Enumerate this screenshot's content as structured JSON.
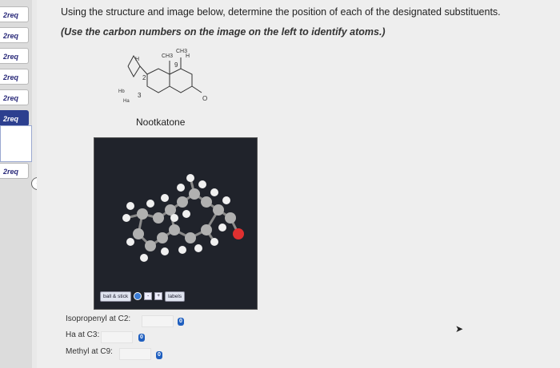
{
  "sidebar": {
    "tabs": [
      {
        "label": "2req",
        "active": false
      },
      {
        "label": "2req",
        "active": false
      },
      {
        "label": "2req",
        "active": false
      },
      {
        "label": "2req",
        "active": false
      },
      {
        "label": "2req",
        "active": false
      },
      {
        "label": "2req",
        "active": true
      },
      {
        "label": "2req",
        "active": false
      }
    ],
    "collapse_icon": "chevron-left-icon"
  },
  "question": {
    "text": "Using the structure and image below, determine the position of each of the designated substituents.",
    "instruction": "(Use the carbon numbers on the image on the left to identify atoms.)"
  },
  "structure": {
    "labels": [
      "H",
      "CH3",
      "H",
      "CH3",
      "2",
      "9",
      "Hb",
      "Ha",
      "3",
      "O"
    ],
    "caption": "Nootkatone"
  },
  "viewer": {
    "mode_label": "ball & stick",
    "labels_label": "labels",
    "plus_label": "+",
    "minus_label": "-"
  },
  "answers": [
    {
      "label": "Isopropenyl at C2:",
      "value": ""
    },
    {
      "label": "Ha at C3:",
      "value": ""
    },
    {
      "label": "Methyl at C9:",
      "value": ""
    }
  ],
  "badge_text": "0",
  "colors": {
    "accent": "#2c3f8f",
    "badge": "#1f5fbf",
    "oxygen": "#e03030"
  }
}
